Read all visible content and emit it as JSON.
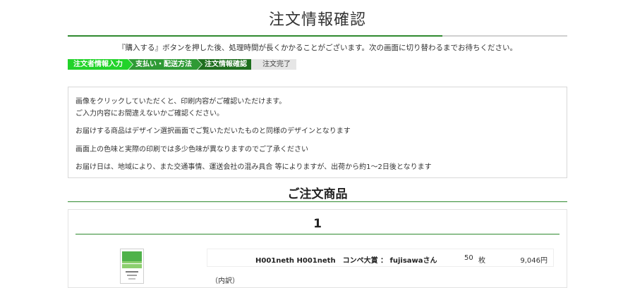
{
  "header": {
    "title": "注文情報確認",
    "progress_fraction": 0.75,
    "notice": "『購入する』ボタンを押した後、処理時間が長くかかることがございます。次の画面に切り替わるまでお待ちください。"
  },
  "steps": [
    {
      "label": "注文者情報入力",
      "color": "#22d32a"
    },
    {
      "label": "支払い・配送方法",
      "color": "#2f9a35"
    },
    {
      "label": "注文情報確認",
      "color": "#1f6f1f"
    },
    {
      "label": "注文完了",
      "color": "#e6e6e6"
    }
  ],
  "info": {
    "line1": "画像をクリックしていただくと、印刷内容がご確認いただけます。",
    "line2": "ご入力内容にお間違えないかご確認ください。",
    "line3": "お届けする商品はデザイン選択画面でご覧いただいたものと同様のデザインとなります",
    "line4": "画面上の色味と実際の印刷では多少色味が異なりますのでご了承ください",
    "line5": "お届け日は、地域により、また交通事情、運送会社の混み具合 等によりますが、出荷から約1〜2日後となります"
  },
  "order": {
    "section_title": "ご注文商品",
    "item_number": "1",
    "product_name": "H001neth  H001neth　コンペ大賞 ： fujisawaさん",
    "quantity": "50",
    "unit": "枚",
    "price": "9,046円",
    "breakdown_label": "（内訳）"
  },
  "colors": {
    "accent": "#2f8a2f",
    "step_active": "#1f6f1f",
    "step_done": "#22d32a"
  }
}
